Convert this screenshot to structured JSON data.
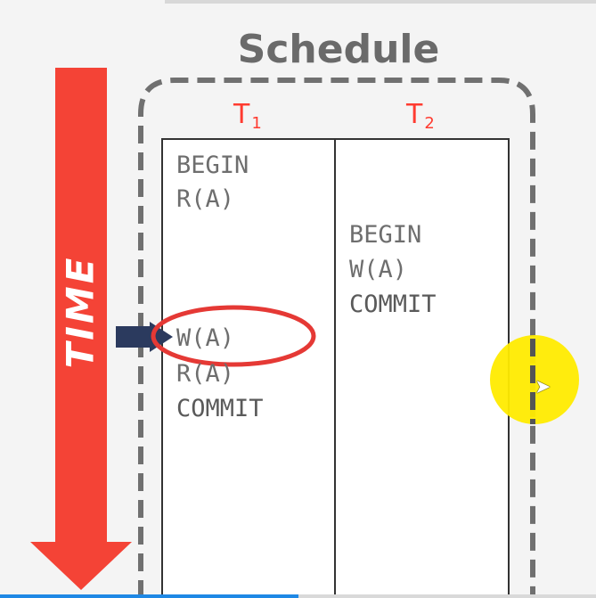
{
  "diagram": {
    "title": "Schedule",
    "time_label": "TIME",
    "transactions": [
      {
        "name": "T",
        "subscript": "1",
        "operations": [
          {
            "text": "BEGIN"
          },
          {
            "text": "R(A)"
          },
          {
            "text": "W(A)",
            "highlighted": true
          },
          {
            "text": "R(A)"
          },
          {
            "text": "COMMIT"
          }
        ]
      },
      {
        "name": "T",
        "subscript": "2",
        "operations": [
          {
            "text": "BEGIN"
          },
          {
            "text": "W(A)"
          },
          {
            "text": "COMMIT"
          }
        ]
      }
    ]
  },
  "colors": {
    "time_arrow": "#f44336",
    "txn_label": "#ff3b30",
    "highlight_ellipse": "#e53935",
    "pointer": "#2b3a5e",
    "cursor_glow": "#ffeb00",
    "schedule_border": "#707070",
    "title": "#6a6a6a"
  },
  "player": {
    "progress": 0.5
  }
}
